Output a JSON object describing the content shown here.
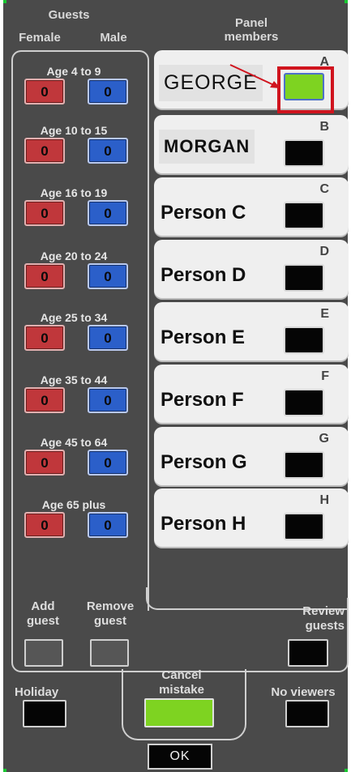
{
  "header": {
    "guests_title": "Guests",
    "female_label": "Female",
    "male_label": "Male",
    "panel_title_line1": "Panel",
    "panel_title_line2": "members"
  },
  "age_groups": [
    {
      "label": "Age 4 to 9",
      "female": "0",
      "male": "0"
    },
    {
      "label": "Age 10 to 15",
      "female": "0",
      "male": "0"
    },
    {
      "label": "Age 16 to 19",
      "female": "0",
      "male": "0"
    },
    {
      "label": "Age 20 to 24",
      "female": "0",
      "male": "0"
    },
    {
      "label": "Age 25 to 34",
      "female": "0",
      "male": "0"
    },
    {
      "label": "Age 35 to 44",
      "female": "0",
      "male": "0"
    },
    {
      "label": "Age 45 to 64",
      "female": "0",
      "male": "0"
    },
    {
      "label": "Age 65 plus",
      "female": "0",
      "male": "0"
    }
  ],
  "panel_members": [
    {
      "letter": "A",
      "name": "GEORGE",
      "active": true
    },
    {
      "letter": "B",
      "name": "MORGAN",
      "active": false
    },
    {
      "letter": "C",
      "name": "Person C",
      "active": false
    },
    {
      "letter": "D",
      "name": "Person D",
      "active": false
    },
    {
      "letter": "E",
      "name": "Person E",
      "active": false
    },
    {
      "letter": "F",
      "name": "Person F",
      "active": false
    },
    {
      "letter": "G",
      "name": "Person G",
      "active": false
    },
    {
      "letter": "H",
      "name": "Person H",
      "active": false
    }
  ],
  "actions": {
    "add_guest_line1": "Add",
    "add_guest_line2": "guest",
    "remove_guest_line1": "Remove",
    "remove_guest_line2": "guest",
    "review_guests_line1": "Review",
    "review_guests_line2": "guests",
    "cancel_mistake_line1": "Cancel",
    "cancel_mistake_line2": "mistake",
    "holiday": "Holiday",
    "no_viewers": "No viewers",
    "ok": "OK"
  },
  "colors": {
    "female_button": "#c0373b",
    "male_button": "#2b5fc9",
    "active_button": "#7ed321",
    "highlight_box": "#d0141e",
    "background": "#4a4a4a"
  }
}
